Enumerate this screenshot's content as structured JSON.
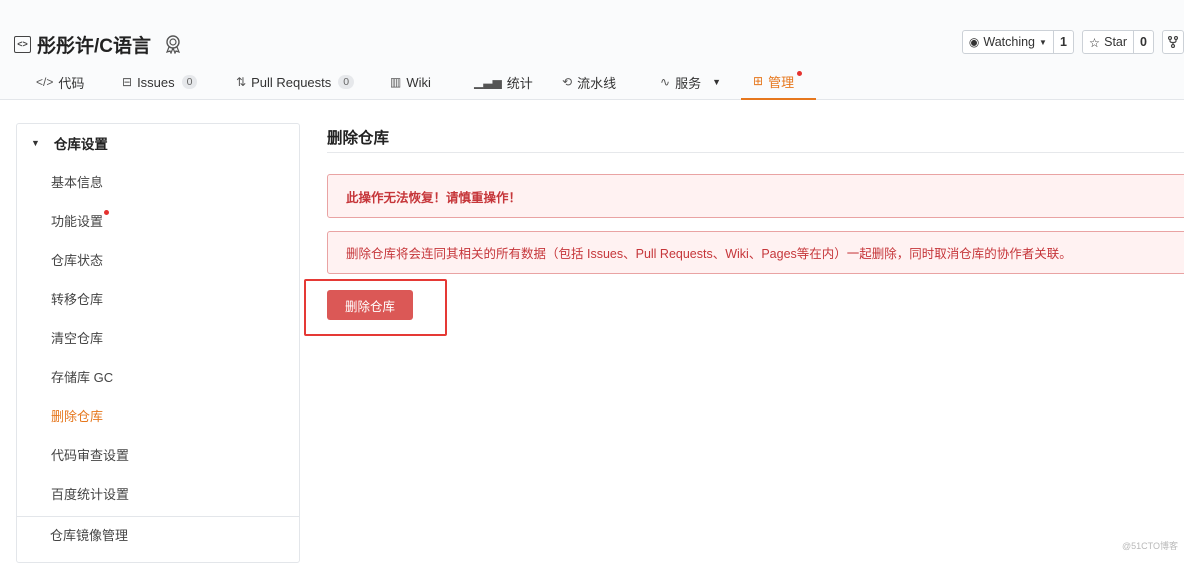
{
  "repo": {
    "title": "彤彤许/C语言",
    "watching": {
      "label": "Watching",
      "count": "1"
    },
    "star": {
      "label": "Star",
      "count": "0"
    }
  },
  "tabs": [
    {
      "label": "代码",
      "icon": "code-icon"
    },
    {
      "label": "Issues",
      "count": "0",
      "icon": "issue-icon"
    },
    {
      "label": "Pull Requests",
      "count": "0",
      "icon": "pull-request-icon"
    },
    {
      "label": "Wiki",
      "icon": "wiki-book-icon"
    },
    {
      "label": "统计",
      "icon": "bar-chart-icon"
    },
    {
      "label": "流水线",
      "icon": "pipeline-icon"
    },
    {
      "label": "服务",
      "icon": "pulse-icon"
    },
    {
      "label": "管理",
      "icon": "manage-icon",
      "active": true
    }
  ],
  "sidebar": {
    "section": "仓库设置",
    "items": [
      {
        "label": "基本信息"
      },
      {
        "label": "功能设置"
      },
      {
        "label": "仓库状态"
      },
      {
        "label": "转移仓库"
      },
      {
        "label": "清空仓库"
      },
      {
        "label": "存储库 GC"
      },
      {
        "label": "删除仓库",
        "active": true
      },
      {
        "label": "代码审查设置"
      },
      {
        "label": "百度统计设置"
      }
    ],
    "bottom_item": "仓库镜像管理"
  },
  "main": {
    "title": "删除仓库",
    "warning": "此操作无法恢复！请慎重操作！",
    "info": "删除仓库将会连同其相关的所有数据（包括 Issues、Pull Requests、Wiki、Pages等在内）一起删除，同时取消仓库的协作者关联。",
    "delete_button": "删除仓库"
  },
  "watermark": "@51CTO博客",
  "colors": {
    "accent": "#e6771d",
    "danger": "#db5856",
    "alert_bg": "#fff2f2",
    "alert_text": "#c6363a",
    "highlight": "#e53935"
  }
}
